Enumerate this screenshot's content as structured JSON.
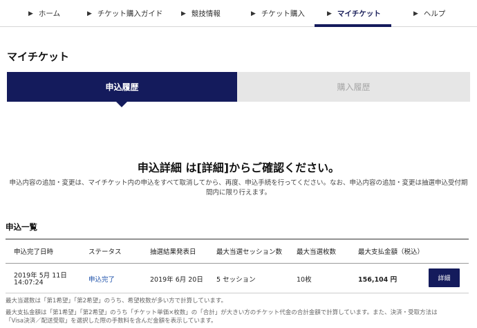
{
  "nav": {
    "items": [
      {
        "label": "ホーム"
      },
      {
        "label": "チケット購入ガイド"
      },
      {
        "label": "競技情報"
      },
      {
        "label": "チケット購入"
      },
      {
        "label": "マイチケット"
      },
      {
        "label": "ヘルプ"
      }
    ],
    "active_index": 4
  },
  "page": {
    "title": "マイチケット"
  },
  "tabs": {
    "active_label": "申込履歴",
    "inactive_label": "購入履歴"
  },
  "notice": {
    "title": "申込詳細 は[詳細]からご確認ください。",
    "line1": "申込内容の追加・変更は、マイチケット内の申込をすべて取消してから、再度、申込手続を行ってください。なお、申込内容の追加・変更は抽選申込受付期",
    "line2": "間内に限り行えます。"
  },
  "section": {
    "title": "申込一覧"
  },
  "table": {
    "columns": [
      "申込完了日時",
      "ステータス",
      "抽選結果発表日",
      "最大当選セッション数",
      "最大当選枚数",
      "最大支払金額（税込）"
    ],
    "rows": [
      {
        "date_line1": "2019年 5月 11日",
        "date_line2": "14:07:24",
        "status": "申込完了",
        "result_date": "2019年 6月 20日",
        "sessions": "5 セッション",
        "tickets": "10枚",
        "amount": "156,104 円",
        "detail_label": "詳細"
      }
    ]
  },
  "footnotes": {
    "note1": "最大当選数は「第1希望」「第2希望」のうち、希望枚数が多い方で計算しています。",
    "note2_line1": "最大支払金額は「第1希望」「第2希望」のうち「チケット単価×枚数」の「合計」が大きい方のチケット代金の合計金額で計算しています。また、決済・受取方法は",
    "note2_line2": "「Visa決済／配送受取」を選択した際の手数料を含んだ金額を表示しています。"
  },
  "colors": {
    "brand_navy": "#141b5c",
    "status_link": "#1a4ea8",
    "inactive_tab": "#e6e6e6"
  }
}
